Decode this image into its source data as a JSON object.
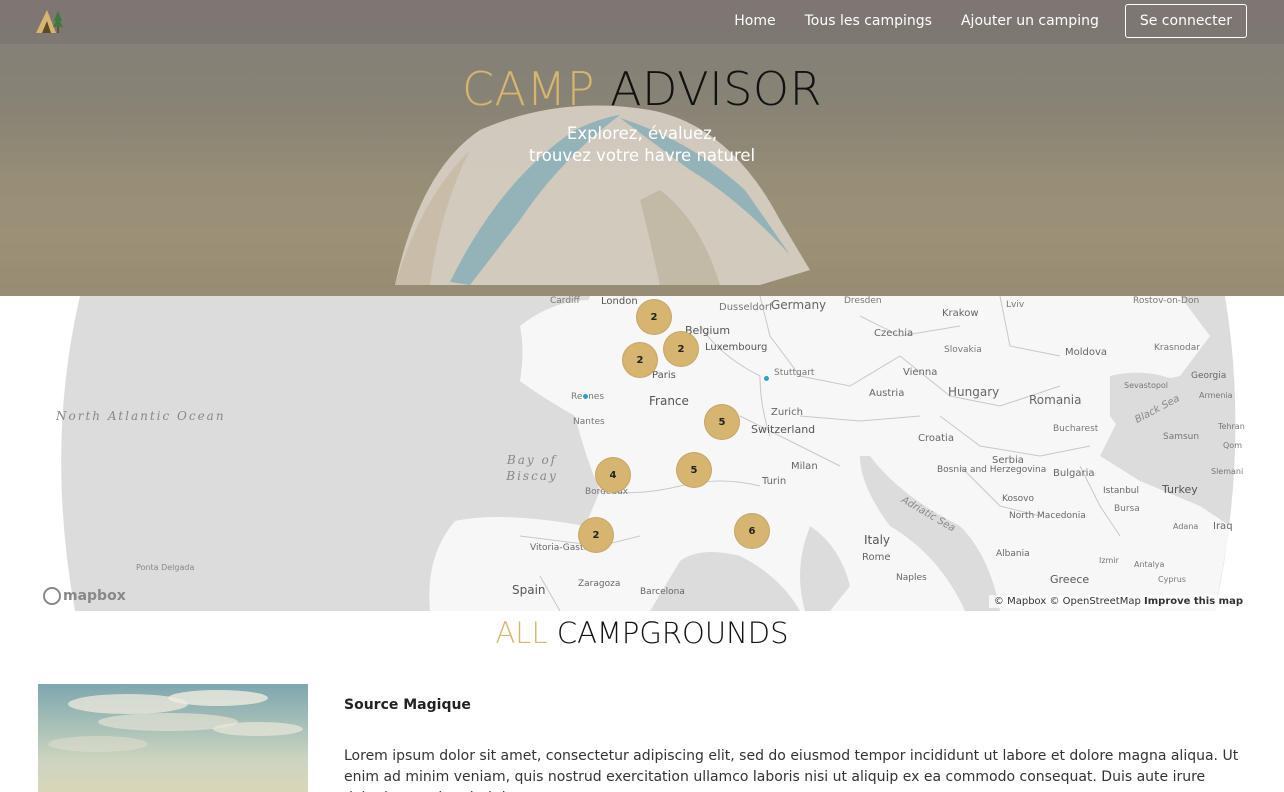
{
  "nav": {
    "logo": "tent-logo-icon",
    "links": [
      "Home",
      "Tous les campings",
      "Ajouter un camping"
    ],
    "login_label": "Se connecter"
  },
  "hero": {
    "title_accent": "CAMP",
    "title_main": "ADVISOR",
    "subtitle_line1": "Explorez, évaluez,",
    "subtitle_line2": "trouvez votre havre naturel"
  },
  "map": {
    "clusters": [
      {
        "count": "2",
        "place": "north-near-london"
      },
      {
        "count": "2",
        "place": "normandy"
      },
      {
        "count": "2",
        "place": "champagne"
      },
      {
        "count": "5",
        "place": "burgundy"
      },
      {
        "count": "5",
        "place": "auvergne"
      },
      {
        "count": "4",
        "place": "bordeaux"
      },
      {
        "count": "2",
        "place": "basque"
      },
      {
        "count": "6",
        "place": "provence"
      }
    ],
    "ocean_label": "North Atlantic Ocean",
    "bay_label": "Bay of Biscay",
    "labels": {
      "germany": "Germany",
      "france": "France",
      "spain": "Spain",
      "italy": "Italy",
      "hungary": "Hungary",
      "romania": "Romania",
      "switzerland": "Switzerland",
      "belgium": "Belgium",
      "luxembourg": "Luxembourg",
      "paris": "Paris",
      "london": "London",
      "cardiff": "Cardiff",
      "dusseldorf": "Dusseldorf",
      "dresden": "Dresden",
      "lviv": "Lviv",
      "krakow": "Krakow",
      "rostov": "Rostov-on-Don",
      "czechia": "Czechia",
      "slovakia": "Slovakia",
      "moldova": "Moldova",
      "krasnodar": "Krasnodar",
      "stuttgart": "Stuttgart",
      "vienna": "Vienna",
      "austria": "Austria",
      "sevastopol": "Sevastopol",
      "georgia": "Georgia",
      "armenia": "Armenia",
      "zurich": "Zurich",
      "rennes": "Rennes",
      "nantes": "Nantes",
      "croatia": "Croatia",
      "bucharest": "Bucharest",
      "black_sea": "Black Sea",
      "samsun": "Samsun",
      "tehran": "Tehran",
      "qom": "Qom",
      "bordeaux": "Bordeaux",
      "milan": "Milan",
      "bosnia": "Bosnia and Herzegovina",
      "serbia": "Serbia",
      "bulgaria": "Bulgaria",
      "slemani": "Slemani",
      "turin": "Turin",
      "adriatic": "Adriatic Sea",
      "istanbul": "Istanbul",
      "turkey": "Turkey",
      "kosovo": "Kosovo",
      "bursa": "Bursa",
      "north_macedonia": "North Macedonia",
      "adana": "Adana",
      "iraq": "Iraq",
      "vitoria": "Vitoria-Gasteiz",
      "rome": "Rome",
      "albania": "Albania",
      "izmir": "Izmir",
      "antalya": "Antalya",
      "ponta": "Ponta Delgada",
      "zaragoza": "Zaragoza",
      "naples": "Naples",
      "greece": "Greece",
      "cyprus": "Cyprus",
      "barcelona": "Barcelona"
    },
    "mapbox_label": "mapbox",
    "attribution": "© Mapbox © OpenStreetMap",
    "improve_label": "Improve this map"
  },
  "section": {
    "title_accent": "ALL",
    "title_main": "CAMPGROUNDS"
  },
  "campground": {
    "name": "Source Magique",
    "description": "Lorem ipsum dolor sit amet, consectetur adipiscing elit, sed do eiusmod tempor incididunt ut labore et dolore magna aliqua. Ut enim ad minim veniam, quis nostrud exercitation ullamco laboris nisi ut aliquip ex ea commodo consequat. Duis aute irure dolor in reprehenderit in"
  },
  "colors": {
    "accent": "#d8b56f",
    "cluster": "#d6b571",
    "pin": "#2aa1c9"
  }
}
